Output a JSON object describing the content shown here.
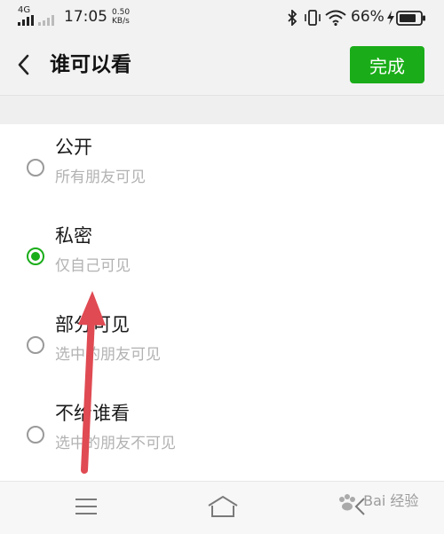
{
  "status_bar": {
    "network": "4G",
    "time": "17:05",
    "speed_value": "0.50",
    "speed_unit": "KB/s",
    "battery": "66%"
  },
  "header": {
    "title": "谁可以看",
    "done_label": "完成"
  },
  "options": [
    {
      "title": "公开",
      "desc": "所有朋友可见",
      "selected": false
    },
    {
      "title": "私密",
      "desc": "仅自己可见",
      "selected": true
    },
    {
      "title": "部分可见",
      "desc": "选中的朋友可见",
      "selected": false
    },
    {
      "title": "不给谁看",
      "desc": "选中的朋友不可见",
      "selected": false
    }
  ],
  "nav_bar": {
    "icons": [
      "menu-icon",
      "home-icon",
      "back-icon"
    ]
  },
  "watermark": "Bai 经验",
  "colors": {
    "accent": "#1aad19",
    "arrow": "#e04a52",
    "desc_text": "#b2b2b2"
  }
}
